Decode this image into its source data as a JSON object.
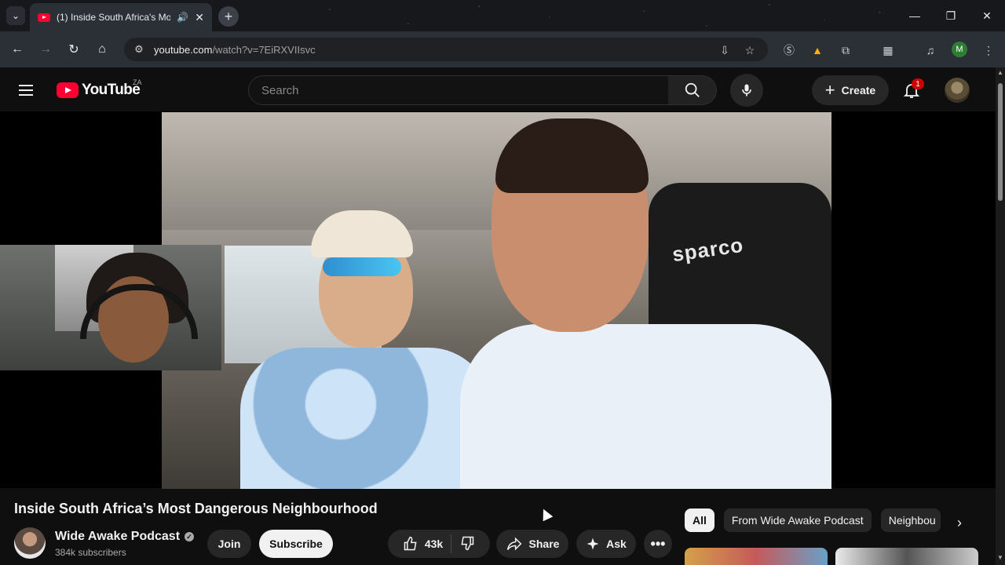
{
  "browser": {
    "tab_title": "(1) Inside South Africa's Mo",
    "url_host": "youtube.com",
    "url_path": "/watch?v=7EiRXVIIsvc",
    "profile_initial": "M",
    "icons": [
      "tab-search-icon",
      "speaker-icon",
      "close-icon",
      "new-tab-icon",
      "back-icon",
      "forward-icon",
      "reload-icon",
      "home-icon",
      "site-info-icon",
      "install-icon",
      "bookmark-star-icon",
      "extension-s-icon",
      "drive-icon",
      "extensions-puzzle-icon",
      "split-view-icon",
      "media-control-icon",
      "chrome-menu-icon",
      "minimize-icon",
      "restore-icon",
      "window-close-icon"
    ]
  },
  "youtube": {
    "logo_text": "YouTube",
    "country_code": "ZA",
    "search_placeholder": "Search",
    "create_label": "Create",
    "notification_count": "1"
  },
  "video": {
    "title": "Inside South Africa’s Most Dangerous Neighbourhood",
    "seat_brand": "sparco"
  },
  "channel": {
    "name": "Wide Awake Podcast",
    "subscribers": "384k subscribers",
    "join_label": "Join",
    "subscribe_label": "Subscribe"
  },
  "actions": {
    "likes": "43k",
    "share_label": "Share",
    "ask_label": "Ask"
  },
  "chips": [
    "All",
    "From Wide Awake Podcast",
    "Neighbou"
  ],
  "colors": {
    "brand_red": "#ff0033",
    "background": "#0f0f0f",
    "pill": "#272727"
  }
}
